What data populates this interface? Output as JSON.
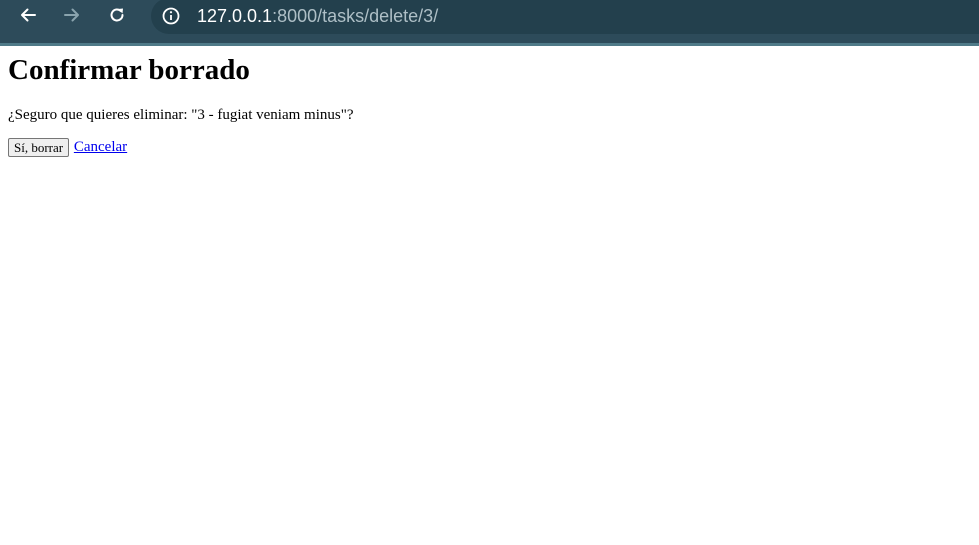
{
  "browser": {
    "url_host": "127.0.0.1",
    "url_path": ":8000/tasks/delete/3/",
    "icons": {
      "back": "arrow-left-icon",
      "forward": "arrow-right-icon",
      "reload": "reload-icon",
      "site_info": "info-icon"
    }
  },
  "page": {
    "title": "Confirmar borrado",
    "question": "¿Seguro que quieres eliminar: \"3 - fugiat veniam minus\"?",
    "confirm_label": "Sí, borrar",
    "cancel_label": "Cancelar"
  },
  "colors": {
    "toolbar": "#2d4b5a",
    "link": "#0000ee"
  }
}
